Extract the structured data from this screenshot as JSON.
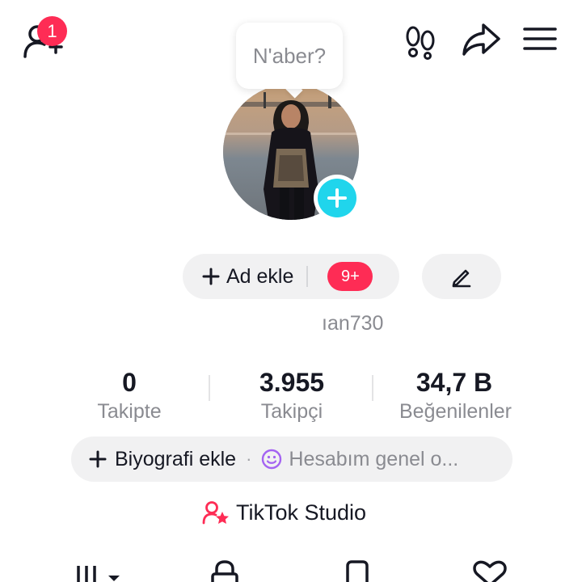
{
  "top_bar": {
    "notification_count": "1",
    "icons": [
      "add-friend-icon",
      "footprint-icon",
      "share-icon",
      "menu-icon"
    ]
  },
  "status_bubble": {
    "text": "N'aber?"
  },
  "profile": {
    "add_name_label": "Ad ekle",
    "add_name_badge": "9+",
    "username": "ıan730"
  },
  "stats": [
    {
      "value": "0",
      "label": "Takipte"
    },
    {
      "value": "3.955",
      "label": "Takipçi"
    },
    {
      "value": "34,7 B",
      "label": "Beğenilenler"
    }
  ],
  "bio": {
    "add_label": "Biyografi ekle",
    "separator": "·",
    "status_text": "Hesabım genel o..."
  },
  "studio": {
    "label": "TikTok Studio"
  },
  "tabs": [
    "videos-grid-icon",
    "lock-icon",
    "bookmark-icon",
    "heart-icon"
  ],
  "colors": {
    "accent_red": "#fe2c55",
    "accent_cyan": "#20d5ec",
    "pill_bg": "#f1f1f2"
  }
}
